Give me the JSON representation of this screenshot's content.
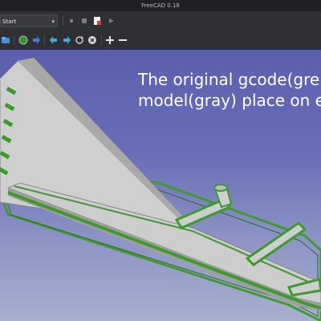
{
  "window": {
    "title": "FreeCAD 0.18"
  },
  "toolbar": {
    "workbench_selected": "Start",
    "icons": [
      "record-macro-icon",
      "stop-macro-icon",
      "macro-editor-icon",
      "run-macro-icon"
    ]
  },
  "toolbar2": {
    "icons": [
      "open-icon",
      "web-icon",
      "forward-arrow-icon",
      "back-arrow-icon",
      "forward-arrow-icon",
      "refresh-icon",
      "stop-icon",
      "zoom-in-icon",
      "zoom-out-icon"
    ]
  },
  "viewport": {
    "overlay_line1": "The original gcode(gre",
    "overlay_line2": "model(gray) place on e"
  },
  "colors": {
    "gcode": "#3e9a2e",
    "model": "#c9c9c9",
    "background_top": "#5a5fae",
    "background_bottom": "#a8afcf"
  }
}
